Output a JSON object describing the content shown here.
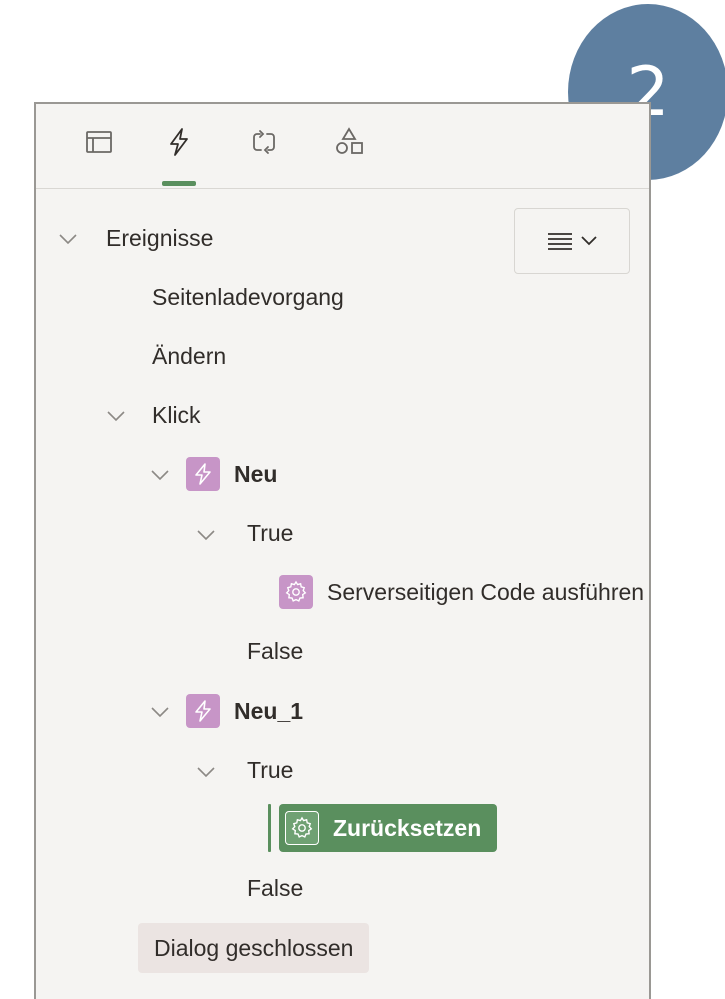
{
  "step_number": "2",
  "tabs": [
    {
      "icon": "layout-icon",
      "active": false
    },
    {
      "icon": "lightning-icon",
      "active": true
    },
    {
      "icon": "refresh-icon",
      "active": false
    },
    {
      "icon": "shapes-icon",
      "active": false
    }
  ],
  "toolbar": {
    "menu_icon": "list-icon",
    "menu_chevron": "chevron-down-icon"
  },
  "tree": {
    "root_label": "Ereignisse",
    "events": {
      "page_load": "Seitenladevorgang",
      "change": "Ändern",
      "click": "Klick",
      "dialog_closed": "Dialog geschlossen"
    },
    "action1": {
      "label": "Neu",
      "true_label": "True",
      "true_action": "Serverseitigen Code ausführen",
      "false_label": "False"
    },
    "action2": {
      "label": "Neu_1",
      "true_label": "True",
      "true_action": "Zurücksetzen",
      "false_label": "False"
    }
  },
  "colors": {
    "accent_green": "#5a8f5e",
    "dynamic_action_purple": "#c795c7",
    "step_badge_blue": "#5e7fa0"
  }
}
